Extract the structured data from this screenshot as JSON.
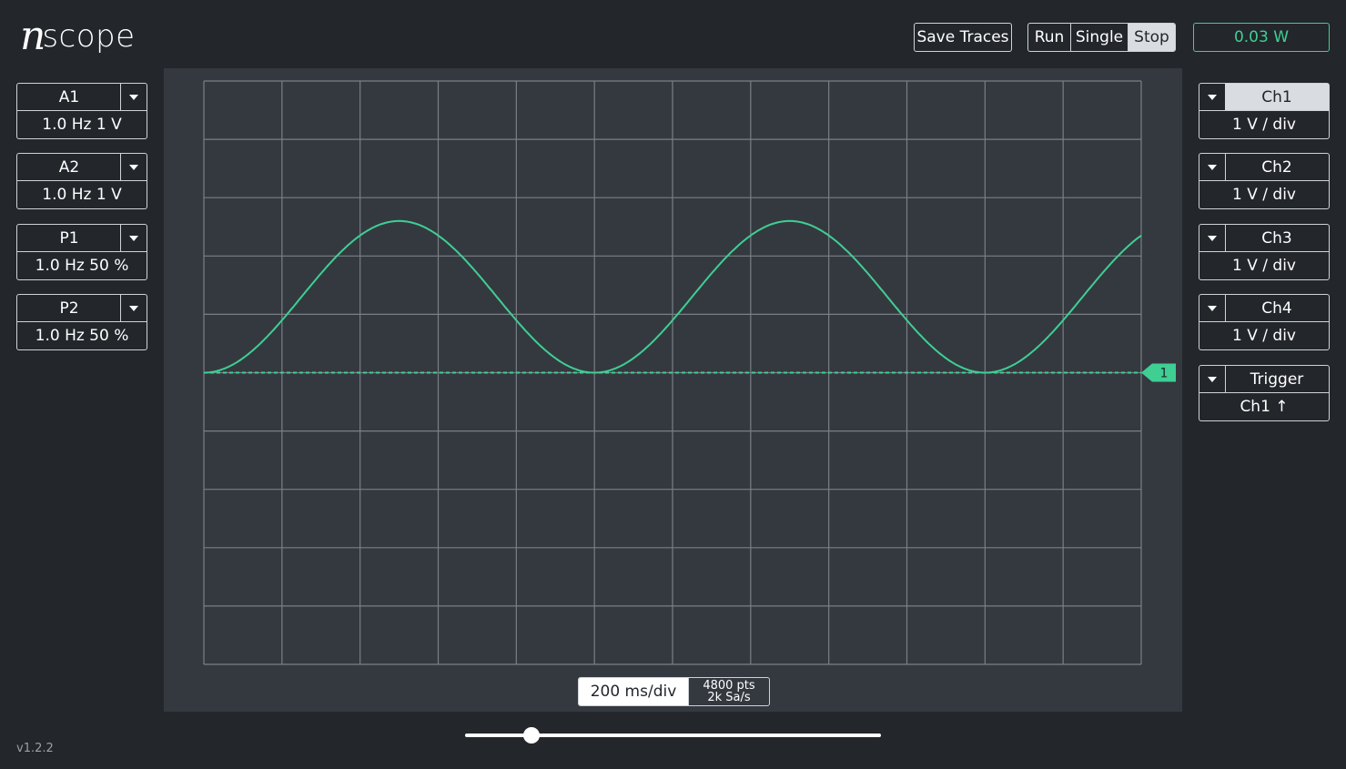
{
  "app": {
    "logo_mark": "n",
    "logo_text": "scope",
    "version": "v1.2.2"
  },
  "toolbar": {
    "save_traces": "Save Traces",
    "run": "Run",
    "single": "Single",
    "stop": "Stop",
    "active_mode": "Stop",
    "power": "0.03 W"
  },
  "outputs": [
    {
      "label": "A1",
      "value": "1.0 Hz 1 V"
    },
    {
      "label": "A2",
      "value": "1.0 Hz 1 V"
    },
    {
      "label": "P1",
      "value": "1.0 Hz 50 %"
    },
    {
      "label": "P2",
      "value": "1.0 Hz 50 %"
    }
  ],
  "channels": [
    {
      "label": "Ch1",
      "value": "1 V / div",
      "active": true
    },
    {
      "label": "Ch2",
      "value": "1 V / div",
      "active": false
    },
    {
      "label": "Ch3",
      "value": "1 V / div",
      "active": false
    },
    {
      "label": "Ch4",
      "value": "1 V / div",
      "active": false
    }
  ],
  "trigger": {
    "label": "Trigger",
    "value": "Ch1 ↑"
  },
  "timebase": {
    "label": "200 ms/div",
    "points": "4800 pts",
    "rate": "2k Sa/s"
  },
  "slider": {
    "position_fraction": 0.16
  },
  "colors": {
    "trace": "#3fcf93",
    "background": "#23262b",
    "plot": "#343940",
    "grid": "#7a7f86"
  },
  "chart_data": {
    "type": "line",
    "title": "",
    "xlabel": "",
    "ylabel": "",
    "x_divisions": 12,
    "y_divisions": 10,
    "time_per_div_ms": 200,
    "volts_per_div": 1,
    "xlim_ms": [
      0,
      2400
    ],
    "ylim_div": [
      -5,
      5
    ],
    "series": [
      {
        "name": "",
        "channel": "Ch1",
        "waveform": "sine",
        "frequency_hz": 1.0,
        "amplitude_v": 1.3,
        "offset_v": 1.3,
        "phase_note": "minimum at t=0"
      }
    ],
    "trigger_marker": {
      "label": "1",
      "level_v": 0
    }
  }
}
